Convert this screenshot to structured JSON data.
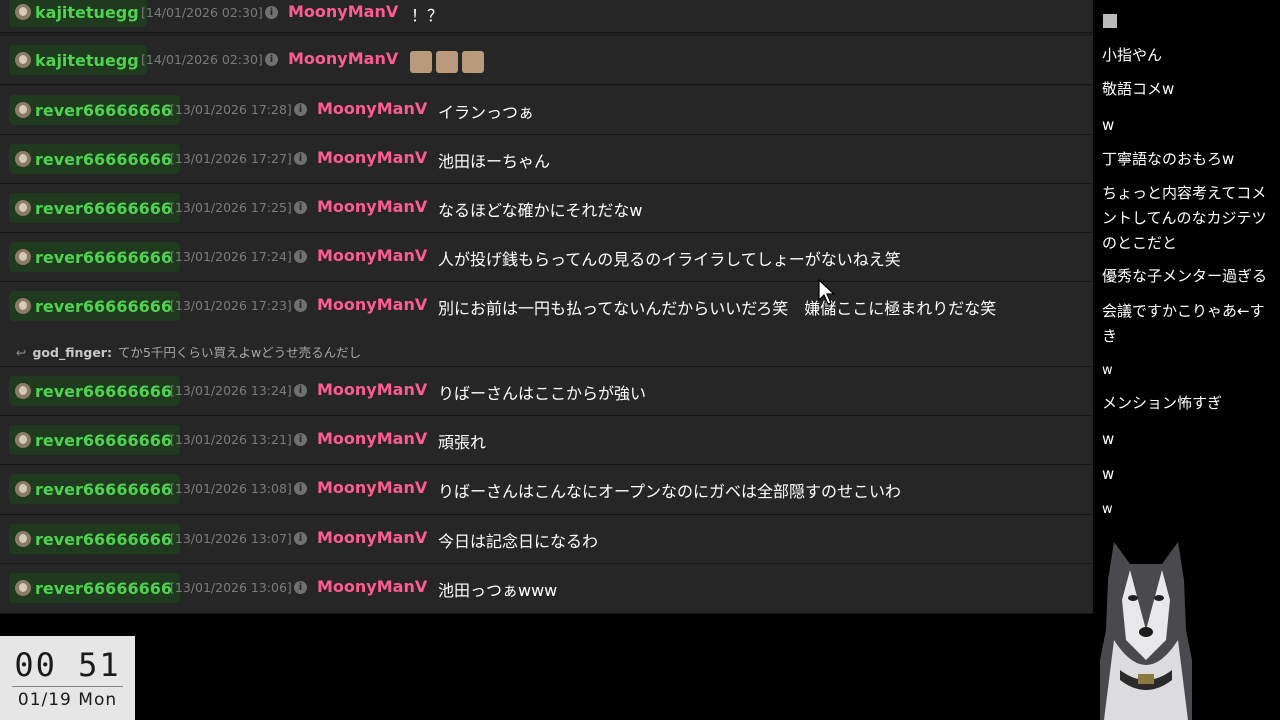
{
  "feed": {
    "rows": [
      {
        "user": "kajitetuegg",
        "time": "[14/01/2026 02:30]",
        "target": "MoonyManV",
        "message": "！？",
        "emotes": 0
      },
      {
        "user": "kajitetuegg",
        "time": "[14/01/2026 02:30]",
        "target": "MoonyManV",
        "message": "",
        "emotes": 3
      },
      {
        "user": "rever66666666",
        "time": "[13/01/2026 17:28]",
        "target": "MoonyManV",
        "message": "イランっつぁ",
        "emotes": 0
      },
      {
        "user": "rever66666666",
        "time": "[13/01/2026 17:27]",
        "target": "MoonyManV",
        "message": "池田ほーちゃん",
        "emotes": 0
      },
      {
        "user": "rever66666666",
        "time": "[13/01/2026 17:25]",
        "target": "MoonyManV",
        "message": "なるほどな確かにそれだなw",
        "emotes": 0
      },
      {
        "user": "rever66666666",
        "time": "[13/01/2026 17:24]",
        "target": "MoonyManV",
        "message": "人が投げ銭もらってんの見るのイライラしてしょーがないねえ笑",
        "emotes": 0
      },
      {
        "user": "rever66666666",
        "time": "[13/01/2026 17:23]",
        "target": "MoonyManV",
        "message": "別にお前は一円も払ってないんだからいいだろ笑　嫌儲ここに極まれりだな笑",
        "emotes": 0,
        "reply": {
          "name": "god_finger:",
          "text": "てか5千円くらい買えよwどうせ売るんだし"
        }
      },
      {
        "user": "rever66666666",
        "time": "[13/01/2026 13:24]",
        "target": "MoonyManV",
        "message": "りばーさんはここからが強い",
        "emotes": 0
      },
      {
        "user": "rever66666666",
        "time": "[13/01/2026 13:21]",
        "target": "MoonyManV",
        "message": "頑張れ",
        "emotes": 0
      },
      {
        "user": "rever66666666",
        "time": "[13/01/2026 13:08]",
        "target": "MoonyManV",
        "message": "りばーさんはこんなにオープンなのにガベは全部隠すのせこいわ",
        "emotes": 0
      },
      {
        "user": "rever66666666",
        "time": "[13/01/2026 13:07]",
        "target": "MoonyManV",
        "message": "今日は記念日になるわ",
        "emotes": 0
      },
      {
        "user": "rever66666666",
        "time": "[13/01/2026 13:06]",
        "target": "MoonyManV",
        "message": "池田っつぁwww",
        "emotes": 0
      }
    ]
  },
  "clock": {
    "time_hh": "00",
    "time_mm": "51",
    "date": "01/19 Mon"
  },
  "side_chat": [
    "小指やん",
    "敬語コメw",
    "w",
    "丁寧語なのおもろw",
    "ちょっと内容考えてコメントしてんのなカジテツのとこだと",
    "優秀な子メンター過ぎる",
    "会議ですかこりゃあ←すき",
    "w",
    "メンション怖すぎ",
    "w",
    "w",
    "w"
  ],
  "colors": {
    "username": "#4fd24f",
    "target": "#ff5c8f",
    "timestamp": "#7b7b7b",
    "row_bg": "#262626"
  }
}
